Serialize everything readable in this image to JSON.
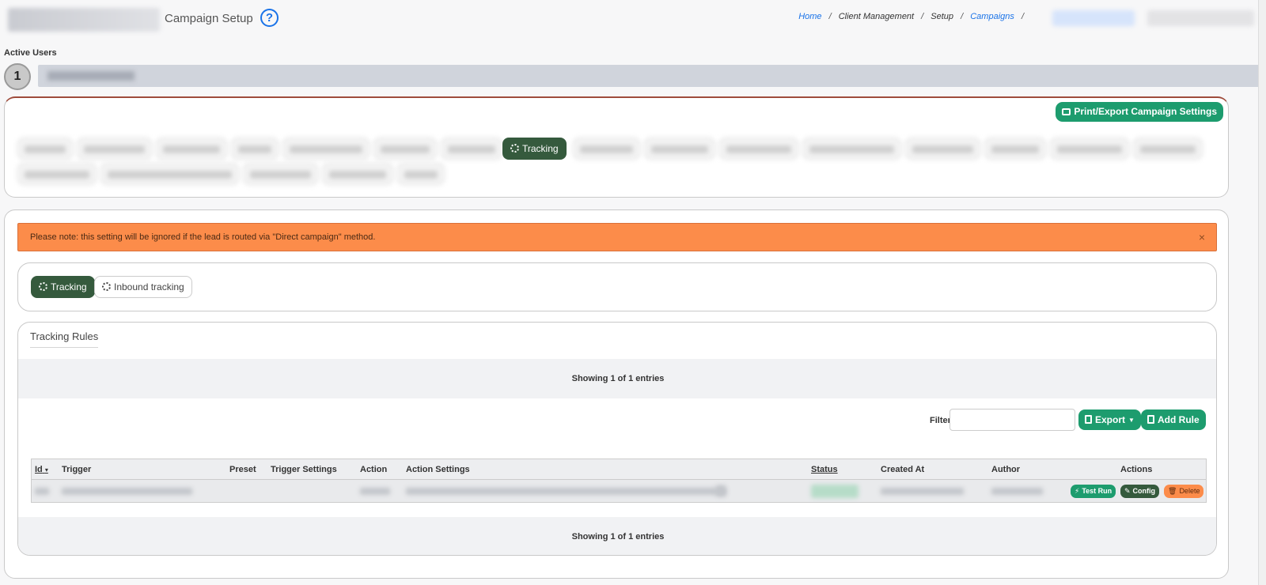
{
  "header": {
    "page_title": "Campaign Setup",
    "help_icon_glyph": "?",
    "breadcrumb": {
      "home": "Home",
      "client_management": "Client Management",
      "setup": "Setup",
      "campaigns": "Campaigns",
      "separator": "/"
    }
  },
  "active_users": {
    "label": "Active Users",
    "count": "1"
  },
  "top_panel": {
    "print_button": "Print/Export Campaign Settings",
    "active_tab": "Tracking"
  },
  "alert": {
    "message": "Please note: this setting will be ignored if the lead is routed via \"Direct campaign\" method.",
    "close": "×"
  },
  "sub_tabs": {
    "tracking": "Tracking",
    "inbound_tracking": "Inbound tracking"
  },
  "rules": {
    "title": "Tracking Rules",
    "showing_top": "Showing 1 of 1 entries",
    "showing_bottom": "Showing 1 of 1 entries",
    "filter_label": "Filter:",
    "filter_value": "",
    "export_button": "Export",
    "add_rule_button": "Add Rule",
    "columns": {
      "id": "Id",
      "id_sort": "▾",
      "trigger": "Trigger",
      "preset": "Preset",
      "trigger_settings": "Trigger Settings",
      "action": "Action",
      "action_settings": "Action Settings",
      "status": "Status",
      "created_at": "Created At",
      "author": "Author",
      "actions": "Actions"
    },
    "row_actions": {
      "test_run": "Test Run",
      "config": "Config",
      "delete": "Delete"
    }
  },
  "icons": {
    "bolt": "⚡",
    "edit": "✎",
    "trash": "🗑",
    "caret": "▼"
  },
  "colors": {
    "primary_green": "#1d9c6e",
    "dark_green": "#355a3d",
    "alert_orange": "#fc8c4a",
    "link_blue": "#1a73e8"
  }
}
